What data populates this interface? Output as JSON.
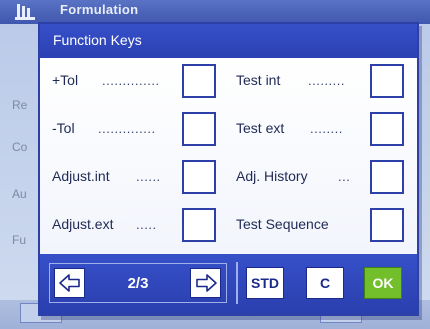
{
  "background": {
    "app_title": "Formulation",
    "side_items": [
      "Re",
      "Co",
      "Au",
      "Fu"
    ]
  },
  "dialog": {
    "title": "Function Keys",
    "rows": [
      {
        "left_label": "+Tol",
        "left_dots": "..............",
        "right_label": "Test int",
        "right_dots": "........."
      },
      {
        "left_label": "-Tol",
        "left_dots": "..............",
        "right_label": "Test ext",
        "right_dots": "........"
      },
      {
        "left_label": "Adjust.int",
        "left_dots": "......",
        "right_label": "Adj. History",
        "right_dots": "..."
      },
      {
        "left_label": "Adjust.ext",
        "left_dots": ".....",
        "right_label": "Test Sequence",
        "right_dots": ""
      }
    ]
  },
  "footer": {
    "page_indicator": "2/3",
    "std_label": "STD",
    "clear_label": "C",
    "ok_label": "OK"
  },
  "colors": {
    "header_blue": "#3750c9",
    "border_blue": "#2c40a8",
    "ok_green": "#73bf2b"
  },
  "icons": [
    "arrow-left-icon",
    "arrow-right-icon",
    "balance-icon"
  ]
}
